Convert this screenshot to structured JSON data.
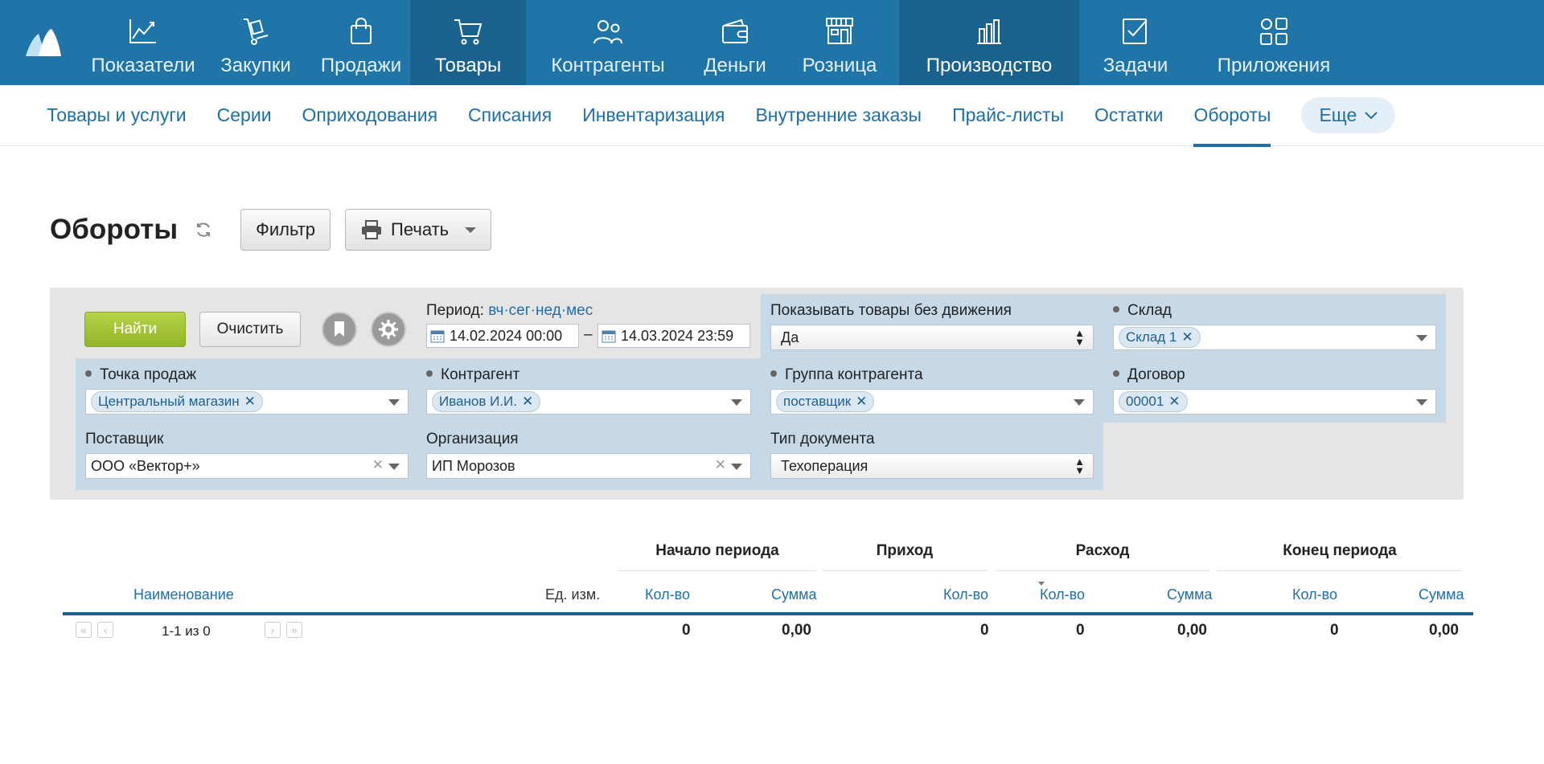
{
  "topnav": {
    "items": [
      {
        "label": "Показатели",
        "icon": "chart-line-icon"
      },
      {
        "label": "Закупки",
        "icon": "hand-truck-icon"
      },
      {
        "label": "Продажи",
        "icon": "shopping-bag-icon"
      },
      {
        "label": "Товары",
        "icon": "cart-icon"
      },
      {
        "label": "Контрагенты",
        "icon": "people-icon"
      },
      {
        "label": "Деньги",
        "icon": "wallet-icon"
      },
      {
        "label": "Розница",
        "icon": "storefront-icon"
      },
      {
        "label": "Производство",
        "icon": "factory-icon"
      },
      {
        "label": "Задачи",
        "icon": "checkbox-icon"
      },
      {
        "label": "Приложения",
        "icon": "apps-grid-icon"
      }
    ],
    "active": "Товары"
  },
  "subnav": {
    "items": [
      "Товары и услуги",
      "Серии",
      "Оприходования",
      "Списания",
      "Инвентаризация",
      "Внутренние заказы",
      "Прайс-листы",
      "Остатки",
      "Обороты"
    ],
    "active": "Обороты",
    "more_label": "Еще"
  },
  "page": {
    "title": "Обороты",
    "filter_btn": "Фильтр",
    "print_btn": "Печать"
  },
  "filter": {
    "find_btn": "Найти",
    "clear_btn": "Очистить",
    "period_label": "Период:",
    "period_links": [
      "вч",
      "сег",
      "нед",
      "мес"
    ],
    "date_from": "14.02.2024 00:00",
    "date_sep": "–",
    "date_to": "14.03.2024 23:59",
    "show_no_movement_label": "Показывать товары без движения",
    "show_no_movement_value": "Да",
    "warehouse_label": "Склад",
    "warehouse_tag": "Склад 1",
    "sale_point_label": "Точка продаж",
    "sale_point_tag": "Центральный магазин",
    "counterparty_label": "Контрагент",
    "counterparty_tag": "Иванов И.И.",
    "cp_group_label": "Группа контрагента",
    "cp_group_tag": "поставщик",
    "contract_label": "Договор",
    "contract_tag": "00001",
    "supplier_label": "Поставщик",
    "supplier_value": "ООО «Вектор+»",
    "org_label": "Организация",
    "org_value": "ИП Морозов",
    "doc_type_label": "Тип документа",
    "doc_type_value": "Техоперация"
  },
  "table": {
    "groups": [
      "Начало периода",
      "Приход",
      "Расход",
      "Конец периода"
    ],
    "columns": {
      "name": "Наименование",
      "unit": "Ед. изм.",
      "qty": "Кол-во",
      "sum": "Сумма"
    },
    "pager": "1-1 из 0",
    "values": {
      "start_qty": "0",
      "start_sum": "0,00",
      "in_qty": "0",
      "out_qty": "0",
      "out_sum": "0,00",
      "end_qty": "0",
      "end_sum": "0,00"
    }
  }
}
